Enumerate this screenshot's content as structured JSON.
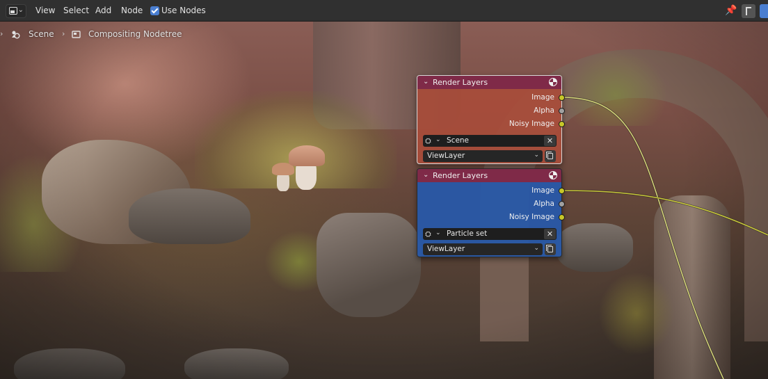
{
  "header": {
    "menu": [
      "View",
      "Select",
      "Add",
      "Node"
    ],
    "use_nodes_label": "Use Nodes",
    "use_nodes_checked": true
  },
  "breadcrumb": {
    "scene": "Scene",
    "nodetree": "Compositing Nodetree"
  },
  "colors": {
    "accent": "#4a7ed0",
    "node_header": "#7f2a48",
    "socket_image": "#c7c729",
    "socket_alpha": "#a1a1a1",
    "node1_body": "#a84c3a",
    "node2_body": "#2858a8"
  },
  "nodes": [
    {
      "title": "Render Layers",
      "outputs": [
        "Image",
        "Alpha",
        "Noisy Image"
      ],
      "scene": "Scene",
      "view_layer": "ViewLayer"
    },
    {
      "title": "Render Layers",
      "outputs": [
        "Image",
        "Alpha",
        "Noisy Image"
      ],
      "scene": "Particle set",
      "view_layer": "ViewLayer"
    }
  ]
}
